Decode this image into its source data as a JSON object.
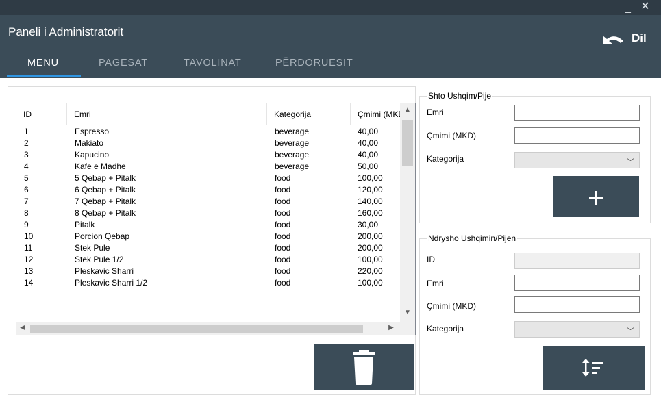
{
  "window": {
    "minimize_label": "_",
    "close_label": "✕"
  },
  "header": {
    "title": "Paneli i Administratorit",
    "language_label": "Dil",
    "tabs": [
      {
        "label": "MENU",
        "active": true
      },
      {
        "label": "PAGESAT",
        "active": false
      },
      {
        "label": "TAVOLINAT",
        "active": false
      },
      {
        "label": "PËRDORUESIT",
        "active": false
      }
    ]
  },
  "menu_table": {
    "columns": [
      "ID",
      "Emri",
      "Kategorija",
      "Çmimi (MKD)"
    ],
    "rows": [
      [
        "1",
        "Espresso",
        "beverage",
        "40,00"
      ],
      [
        "2",
        "Makiato",
        "beverage",
        "40,00"
      ],
      [
        "3",
        "Kapucino",
        "beverage",
        "40,00"
      ],
      [
        "4",
        "Kafe e Madhe",
        "beverage",
        "50,00"
      ],
      [
        "5",
        "5 Qebap + Pitalk",
        "food",
        "100,00"
      ],
      [
        "6",
        "6 Qebap + Pitalk",
        "food",
        "120,00"
      ],
      [
        "7",
        "7 Qebap + Pitalk",
        "food",
        "140,00"
      ],
      [
        "8",
        "8 Qebap + Pitalk",
        "food",
        "160,00"
      ],
      [
        "9",
        "Pitalk",
        "food",
        "30,00"
      ],
      [
        "10",
        "Porcion Qebap",
        "food",
        "200,00"
      ],
      [
        "11",
        "Stek Pule",
        "food",
        "200,00"
      ],
      [
        "12",
        "Stek Pule 1/2",
        "food",
        "100,00"
      ],
      [
        "13",
        "Pleskavic Sharri",
        "food",
        "220,00"
      ],
      [
        "14",
        "Pleskavic Sharri 1/2",
        "food",
        "100,00"
      ]
    ]
  },
  "add_form": {
    "title": "Shto Ushqim/Pije",
    "name_label": "Emri",
    "price_label": "Çmimi (MKD)",
    "category_label": "Kategorija",
    "name_value": "",
    "price_value": "",
    "category_value": "",
    "add_button_symbol": "+"
  },
  "edit_form": {
    "title": "Ndrysho Ushqimin/Pijen",
    "id_label": "ID",
    "name_label": "Emri",
    "price_label": "Çmimi (MKD)",
    "category_label": "Kategorija",
    "id_value": "",
    "name_value": "",
    "price_value": "",
    "category_value": ""
  },
  "icons": {
    "language": "undo-arrow-icon",
    "delete": "trash-icon",
    "update": "sort-update-icon",
    "add": "plus-icon"
  },
  "colors": {
    "titlebar": "#2f3b45",
    "header": "#3b4c58",
    "tab_underline": "#2f95e2",
    "button": "#3b4c58"
  }
}
